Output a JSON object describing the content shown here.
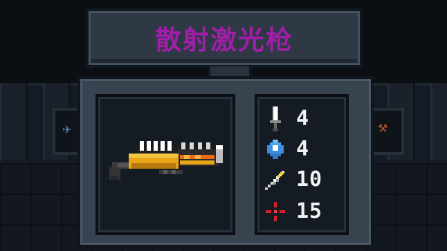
{
  "item": {
    "name": "散射激光枪",
    "name_color": "#a11ea9"
  },
  "weapon": {
    "icon": "scatter-laser-gun-icon"
  },
  "stats": [
    {
      "icon": "sword-icon",
      "label": "damage",
      "value": "4"
    },
    {
      "icon": "energy-crystal-icon",
      "label": "energy cost",
      "value": "4"
    },
    {
      "icon": "crit-feather-icon",
      "label": "critical",
      "value": "10"
    },
    {
      "icon": "crosshair-icon",
      "label": "spread",
      "value": "15"
    }
  ],
  "colors": {
    "panel": "#37434f",
    "frame": "#151b23",
    "stat_text": "#f2f2f2",
    "gun_accent": "#e8a516"
  }
}
